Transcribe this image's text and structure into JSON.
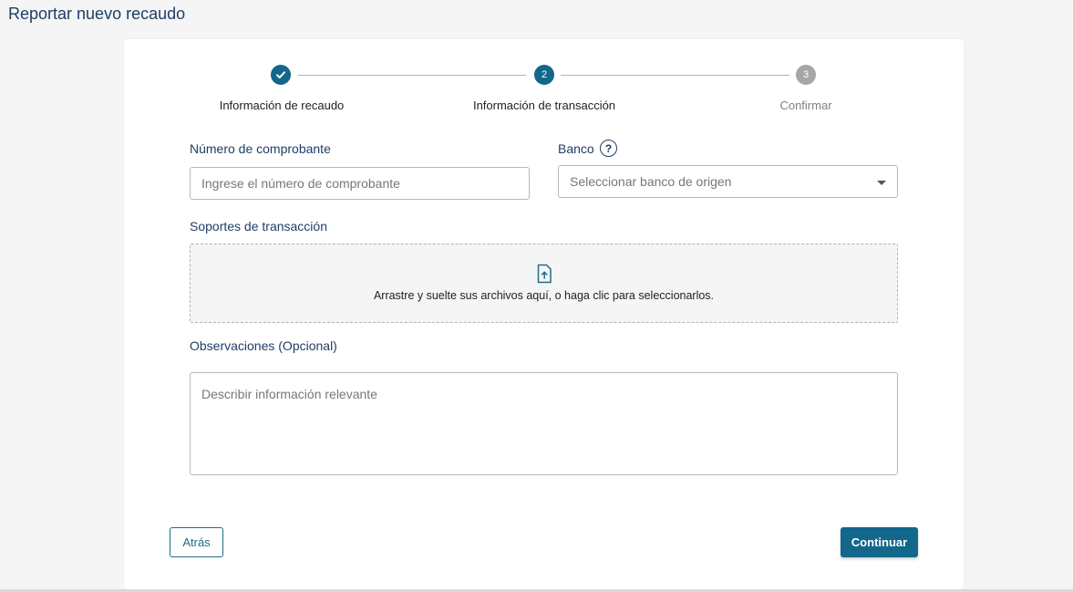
{
  "page": {
    "title": "Reportar nuevo recaudo"
  },
  "stepper": {
    "steps": [
      {
        "number": "1",
        "label": "Información de recaudo",
        "state": "completed"
      },
      {
        "number": "2",
        "label": "Información de transacción",
        "state": "active"
      },
      {
        "number": "3",
        "label": "Confirmar",
        "state": "pending"
      }
    ],
    "colors": {
      "completed": "#12678a",
      "active": "#12678a",
      "pending": "#a6a6a6"
    }
  },
  "form": {
    "voucher": {
      "label": "Número de comprobante",
      "placeholder": "Ingrese el número de comprobante",
      "value": ""
    },
    "bank": {
      "label": "Banco",
      "help_icon": "question-circle-icon",
      "placeholder": "Seleccionar banco de origen"
    },
    "supports": {
      "label": "Soportes de transacción",
      "icon": "file-upload-icon",
      "hint": "Arrastre y suelte sus archivos aquí, o haga clic para seleccionarlos."
    },
    "observations": {
      "label": "Observaciones (Opcional)",
      "placeholder": "Describir información relevante",
      "value": ""
    }
  },
  "actions": {
    "back_label": "Atrás",
    "continue_label": "Continuar"
  }
}
